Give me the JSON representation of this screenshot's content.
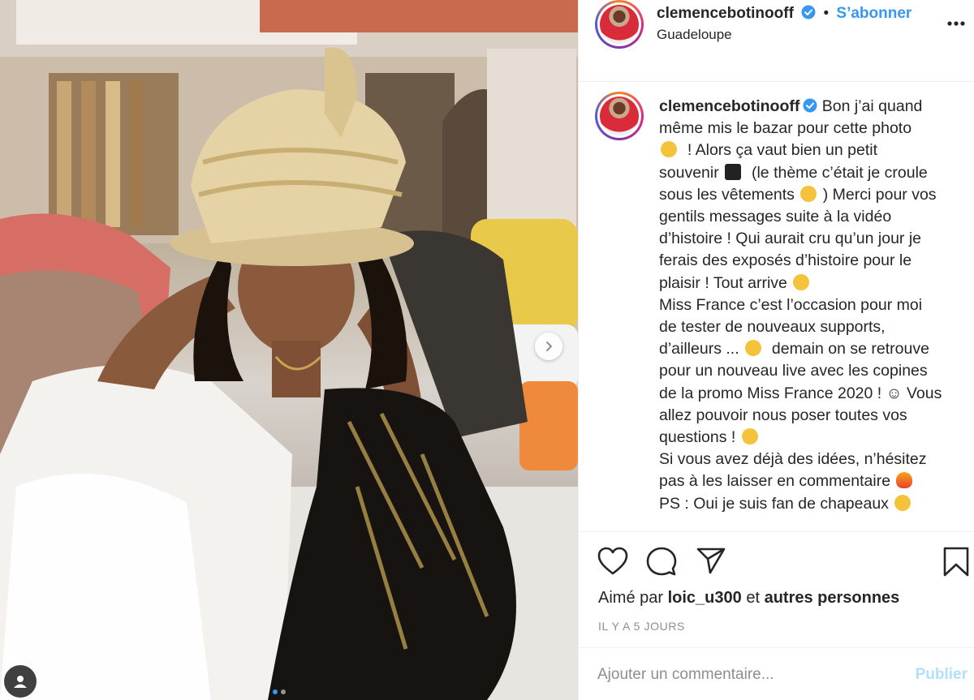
{
  "post": {
    "username": "clemencebotinooff",
    "follow_label": "S’abonner",
    "location": "Guadeloupe",
    "caption_lines": [
      "Bon j’ai quand",
      "même mis le bazar pour cette photo",
      "! Alors ça vaut bien un petit",
      "souvenir",
      "(le thème c’était je croule",
      "sous les vêtements",
      ") Merci pour vos",
      "gentils messages suite à la vidéo",
      "d’histoire ! Qui aurait cru qu’un jour je",
      "ferais des exposés d’histoire pour le",
      "plaisir ! Tout arrive",
      "Miss France c’est l’occasion pour moi",
      "de tester de nouveaux supports,",
      "d’ailleurs ...",
      "demain on se retrouve",
      "pour un nouveau live avec les copines",
      "de la promo Miss France 2020 ! ☺ Vous",
      "allez pouvoir nous poser toutes vos",
      "questions !",
      "Si vous avez déjà des idées, n’hésitez",
      "pas à les laisser en commentaire",
      "",
      "PS : Oui je suis fan de chapeaux"
    ],
    "likes_prefix": "Aimé par",
    "likes_user": "loic_u300",
    "likes_and": "et",
    "likes_others": "autres personnes",
    "time_ago": "IL Y A 5 JOURS",
    "comment_placeholder": "Ajouter un commentaire...",
    "publish_label": "Publier"
  },
  "icons": {
    "like": "heart-icon",
    "comment": "speech-bubble-icon",
    "share": "paper-plane-icon",
    "save": "bookmark-icon",
    "more": "ellipsis-icon",
    "next": "chevron-right-icon",
    "tag": "user-tag-icon",
    "verified": "verified-badge-icon"
  },
  "colors": {
    "link_blue": "#3897f0",
    "publish_disabled": "#b2dffc",
    "muted": "#8e8e8e",
    "text": "#262626"
  },
  "carousel": {
    "slides": 2,
    "active": 1
  }
}
